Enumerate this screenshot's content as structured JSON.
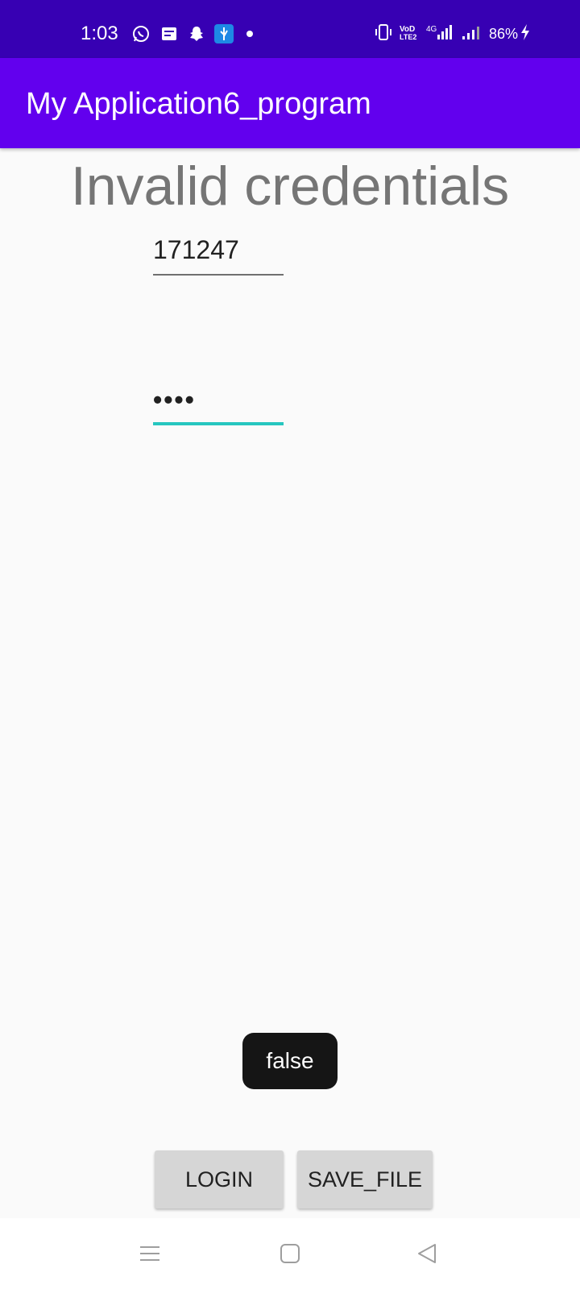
{
  "status_bar": {
    "time": "1:03",
    "battery": "86%",
    "icons": [
      "whatsapp-icon",
      "message-icon",
      "snapchat-icon",
      "usb-icon",
      "dot-icon",
      "vibrate-icon",
      "volte-icon",
      "signal-4g-icon",
      "signal-icon",
      "battery-charging-icon"
    ]
  },
  "app_bar": {
    "title": "My Application6_program",
    "color": "#6200ee"
  },
  "main": {
    "heading": "Invalid credentials",
    "username_value": "171247",
    "password_value": "••••"
  },
  "toast": {
    "text": "false"
  },
  "buttons": {
    "login": "LOGIN",
    "save_file": "SAVE_FILE"
  },
  "nav_bar": {
    "icons": [
      "menu-icon",
      "home-icon",
      "back-icon"
    ]
  }
}
